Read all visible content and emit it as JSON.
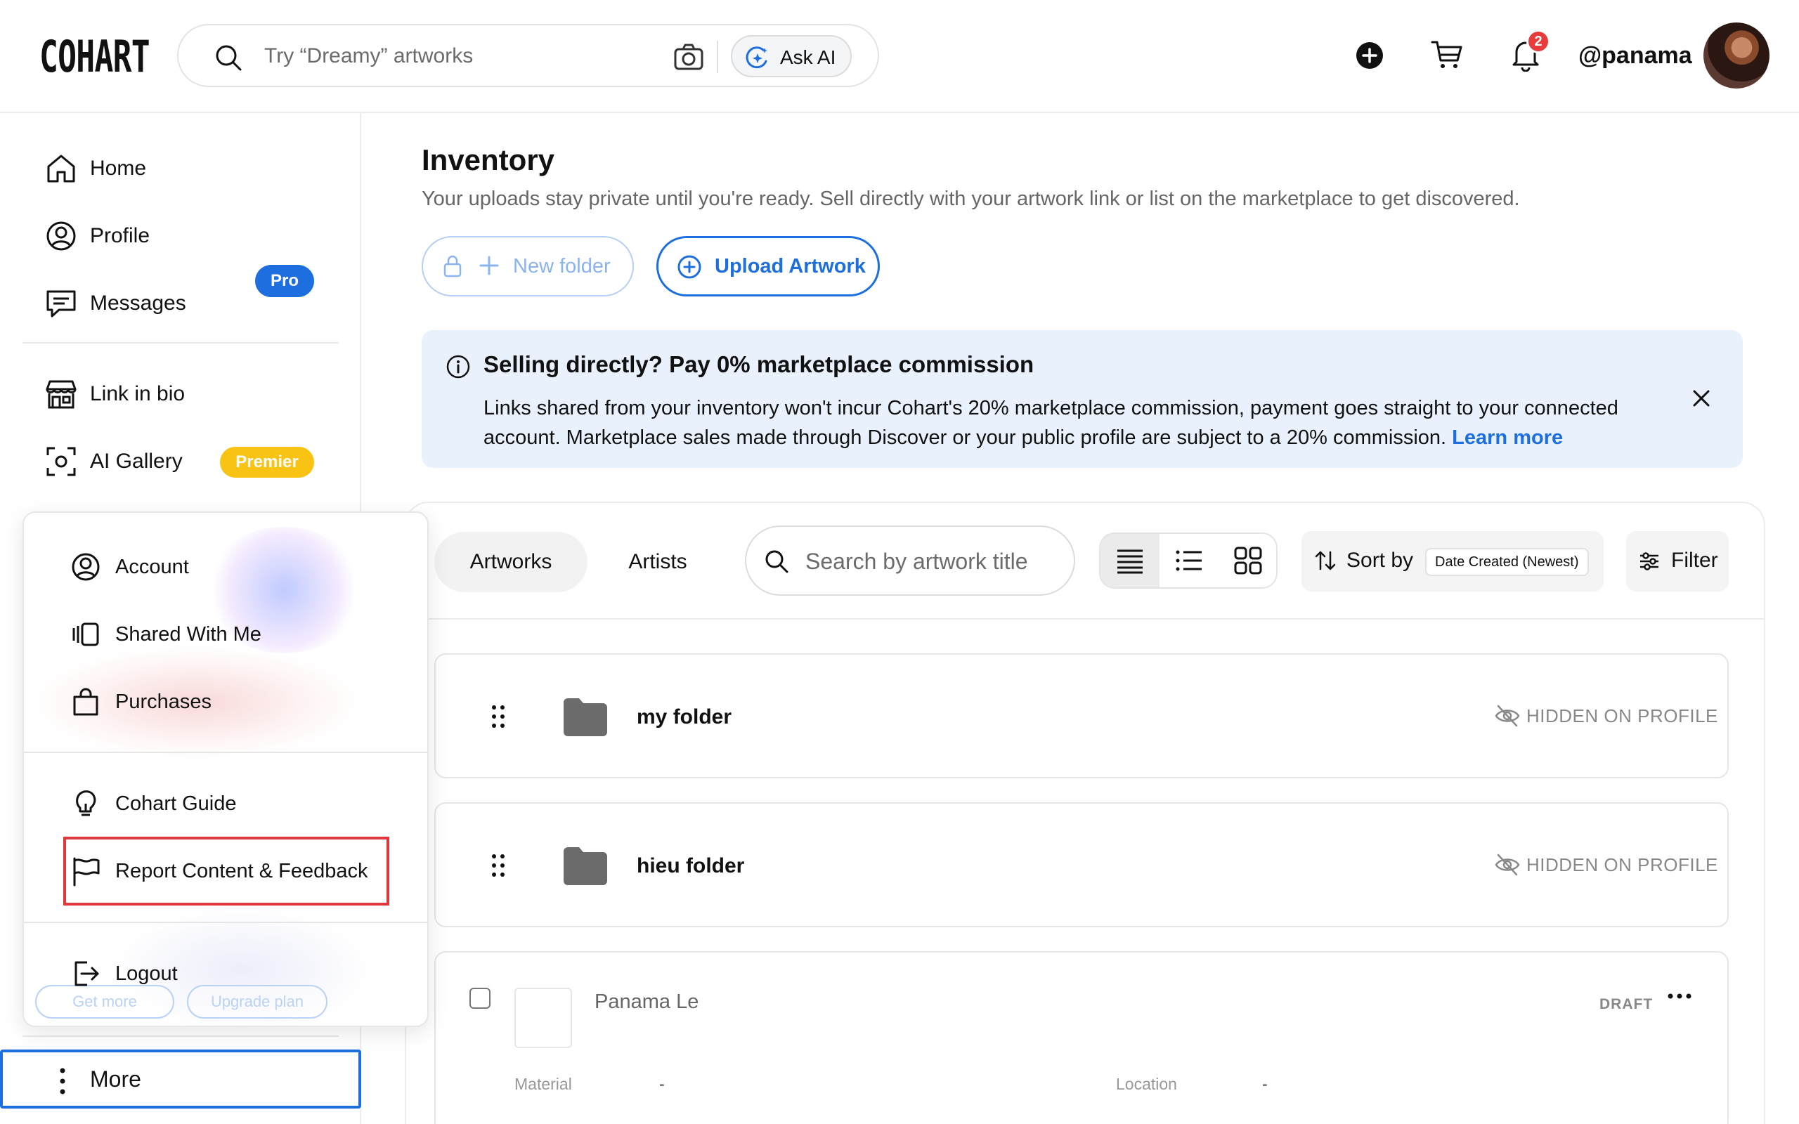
{
  "colors": {
    "accent": "#1d6fe0",
    "premier": "#f8c312",
    "notification": "#e83b3b",
    "banner_bg": "#e9f1fd",
    "highlight_border": "#e0373f"
  },
  "header": {
    "logo": "COHART",
    "search_placeholder": "Try “Dreamy” artworks",
    "ask_ai_label": "Ask AI",
    "notification_count": "2",
    "username": "@panama",
    "icons": [
      "search-icon",
      "camera-icon",
      "sparkle-icon",
      "plus-circle-icon",
      "cart-icon",
      "bell-icon",
      "avatar"
    ]
  },
  "sidebar": {
    "items": [
      {
        "label": "Home",
        "icon": "home-icon"
      },
      {
        "label": "Profile",
        "icon": "profile-icon"
      },
      {
        "label": "Messages",
        "icon": "messages-icon"
      },
      {
        "label": "Link in bio",
        "icon": "storefront-icon",
        "badge": "Pro"
      },
      {
        "label": "AI Gallery",
        "icon": "ai-scan-icon",
        "badge": "Premier"
      }
    ],
    "more_label": "More"
  },
  "more_menu": {
    "items": [
      {
        "label": "Account",
        "icon": "account-icon"
      },
      {
        "label": "Shared With Me",
        "icon": "shared-icon"
      },
      {
        "label": "Purchases",
        "icon": "bag-icon"
      },
      {
        "label": "Cohart Guide",
        "icon": "lightbulb-icon"
      },
      {
        "label": "Report Content & Feedback",
        "icon": "flag-icon",
        "highlighted": true
      },
      {
        "label": "Logout",
        "icon": "logout-icon"
      }
    ],
    "get_more_label": "Get more",
    "upgrade_label": "Upgrade plan"
  },
  "main": {
    "title": "Inventory",
    "subtitle": "Your uploads stay private until you're ready. Sell directly with your artwork link or list on the marketplace to get discovered.",
    "new_folder_label": "New folder",
    "upload_label": "Upload Artwork",
    "banner": {
      "title": "Selling directly? Pay 0% marketplace commission",
      "body": "Links shared from your inventory won't incur Cohart's 20% marketplace commission, payment goes straight to your connected account. Marketplace sales made through Discover or your public profile are subject to a 20% commission.",
      "link": "Learn more"
    },
    "tabs": [
      "Artworks",
      "Artists"
    ],
    "active_tab": "Artworks",
    "search_placeholder": "Search by artwork title",
    "view_modes": [
      "compact-list",
      "list",
      "grid"
    ],
    "active_view": "compact-list",
    "sort_label": "Sort by",
    "sort_value": "Date Created (Newest)",
    "filter_label": "Filter",
    "folders": [
      {
        "name": "my folder",
        "visibility": "HIDDEN ON PROFILE"
      },
      {
        "name": "hieu folder",
        "visibility": "HIDDEN ON PROFILE"
      }
    ],
    "artwork": {
      "artist": "Panama Le",
      "status": "DRAFT",
      "material_label": "Material",
      "material_value": "-",
      "location_label": "Location",
      "location_value": "-"
    }
  }
}
